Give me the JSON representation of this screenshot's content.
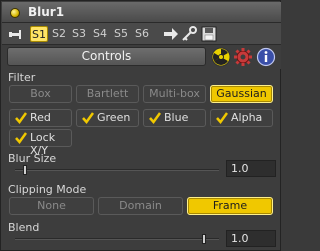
{
  "window": {
    "title": "Blur1"
  },
  "toolbar": {
    "slots": [
      "S1",
      "S2",
      "S3",
      "S4",
      "S5",
      "S6"
    ],
    "active_slot": "S1"
  },
  "tabs": {
    "controls_label": "Controls",
    "icons": [
      "radiation-icon",
      "gear-icon",
      "info-icon"
    ]
  },
  "filter": {
    "label": "Filter",
    "options": [
      "Box",
      "Bartlett",
      "Multi-box",
      "Gaussian"
    ],
    "selected": "Gaussian"
  },
  "channels": {
    "red": {
      "label": "Red",
      "checked": true
    },
    "green": {
      "label": "Green",
      "checked": true
    },
    "blue": {
      "label": "Blue",
      "checked": true
    },
    "alpha": {
      "label": "Alpha",
      "checked": true
    },
    "lock": {
      "label": "Lock X/Y",
      "checked": true
    }
  },
  "blur_size": {
    "label": "Blur Size",
    "value": "1.0",
    "slider_fraction": 0.0
  },
  "clipping_mode": {
    "label": "Clipping Mode",
    "options": [
      "None",
      "Domain",
      "Frame"
    ],
    "selected": "Frame"
  },
  "blend": {
    "label": "Blend",
    "value": "1.0",
    "slider_fraction": 1.0
  },
  "colors": {
    "accent": "#f0c800",
    "panel_bg": "#3d3d3d",
    "titlebar_top": "#6a6a6a"
  }
}
